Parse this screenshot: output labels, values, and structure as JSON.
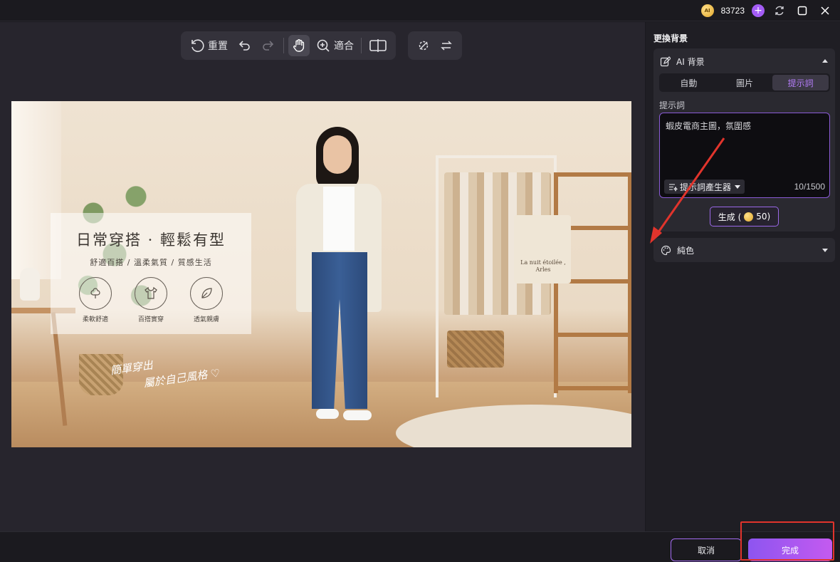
{
  "titlebar": {
    "coin_label": "AI",
    "credits": "83723",
    "plus": "+"
  },
  "toolbar": {
    "reset_label": "重置",
    "fit_label": "適合"
  },
  "photo": {
    "promo_title": "日常穿搭 · 輕鬆有型",
    "promo_subtitle": "舒適百搭 / 溫柔氣質 / 質感生活",
    "features": [
      "柔軟舒適",
      "百搭實穿",
      "透氣親膚"
    ],
    "script_line1": "簡單穿出",
    "script_line2": "屬於自己風格 ♡",
    "tote_text": "La nuit étoilée , Arles"
  },
  "panel": {
    "title": "更換背景",
    "ai_bg_label": "AI 背景",
    "tabs": [
      {
        "label": "自動",
        "active": false
      },
      {
        "label": "圖片",
        "active": false
      },
      {
        "label": "提示詞",
        "active": true
      }
    ],
    "prompt_label": "提示詞",
    "prompt_value": "蝦皮電商主圖，氛圍感",
    "prompt_generator_label": "提示詞產生器",
    "counter": "10/1500",
    "generate_label": "生成 (",
    "generate_cost": "50)",
    "solid_label": "純色"
  },
  "footer": {
    "cancel_label": "取消",
    "done_label": "完成"
  },
  "colors": {
    "accent": "#a35cf5",
    "annotation": "#e1342c"
  }
}
